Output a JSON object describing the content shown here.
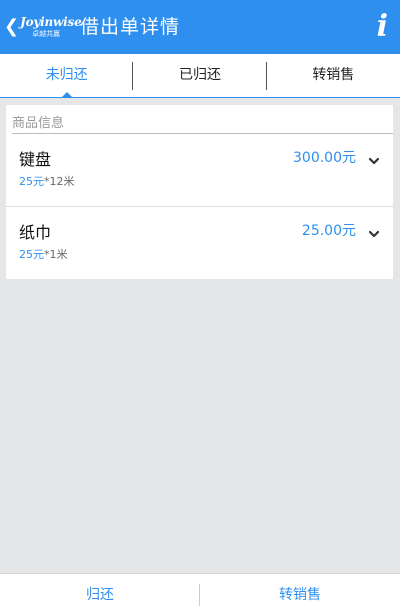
{
  "header": {
    "back_chevron": "❮",
    "logo_main": "Joyinwise",
    "logo_sub": "卓越共赢",
    "title": "借出单详情",
    "info_icon": "i"
  },
  "tabs": [
    {
      "label": "未归还",
      "active": true
    },
    {
      "label": "已归还",
      "active": false
    },
    {
      "label": "转销售",
      "active": false
    }
  ],
  "section": {
    "label": "商品信息"
  },
  "items": [
    {
      "name": "键盘",
      "total": "300.00元",
      "price": "25元",
      "qty": "*12米"
    },
    {
      "name": "纸巾",
      "total": "25.00元",
      "price": "25元",
      "qty": "*1米"
    }
  ],
  "actions": {
    "return_label": "归还",
    "sell_label": "转销售"
  },
  "colors": {
    "accent": "#2f8fef",
    "background": "#e5e6e8"
  }
}
